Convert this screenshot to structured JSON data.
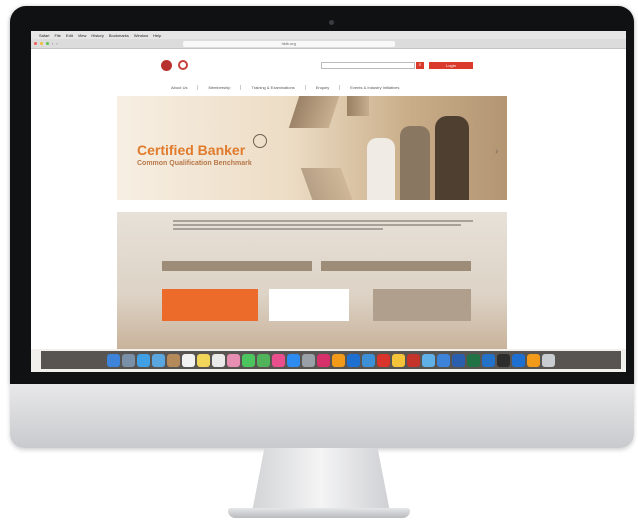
{
  "browser": {
    "menubar_items": [
      "Safari",
      "File",
      "Edit",
      "View",
      "History",
      "Bookmarks",
      "Window",
      "Help"
    ],
    "menubar_right": "",
    "url": "hkib.org"
  },
  "site": {
    "logo_text": "",
    "toplinks": [
      "",
      "",
      "",
      "",
      ""
    ],
    "search_placeholder": "",
    "login_label": "Login",
    "nav_items": [
      "About Us",
      "Membership",
      "Training & Examinations",
      "Enquiry",
      "Events & Industry Initiatives"
    ],
    "hero": {
      "title": "Certified Banker",
      "subtitle": "Common Qualification Benchmark",
      "caption": ""
    },
    "intro_more": "",
    "bars": [
      "",
      ""
    ],
    "cards": {
      "orange": "",
      "white_lines": [
        "",
        "",
        ""
      ],
      "grey": ""
    }
  },
  "colors": {
    "accent_red": "#d93a2b",
    "accent_orange": "#ed6b2a",
    "hero_title": "#e07a2c"
  },
  "dock_icons": [
    "finder-icon",
    "launchpad-icon",
    "safari-icon",
    "mail-icon",
    "contacts-icon",
    "calendar-icon",
    "notes-icon",
    "reminders-icon",
    "photos-icon",
    "messages-icon",
    "facetime-icon",
    "itunes-icon",
    "app-store-icon",
    "system-preferences-icon",
    "indesign-icon",
    "illustrator-icon",
    "photoshop-icon",
    "lightroom-icon",
    "acrobat-icon",
    "chrome-icon",
    "filezilla-icon",
    "preview-icon",
    "finder-2-icon",
    "word-icon",
    "excel-icon",
    "outlook-icon",
    "terminal-icon",
    "photoshop-2-icon",
    "illustrator-2-icon",
    "trash-icon"
  ]
}
